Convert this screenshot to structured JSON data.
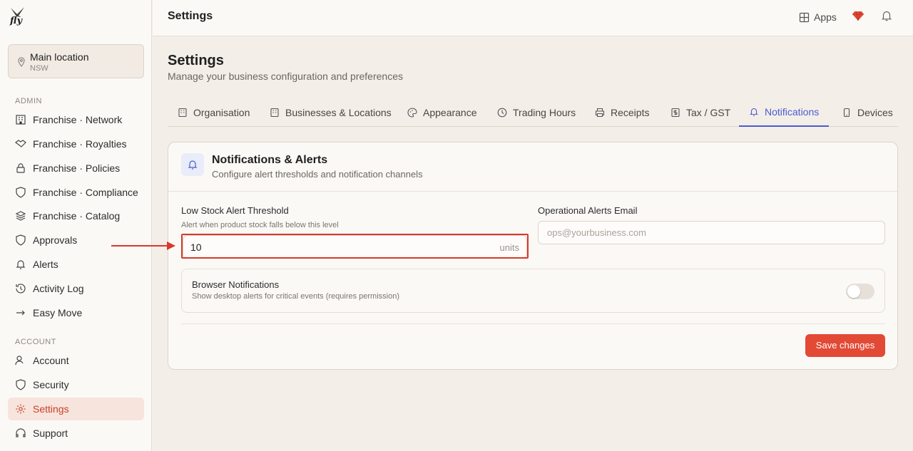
{
  "app": {
    "logo_text": "fly",
    "page_title": "Settings"
  },
  "location": {
    "name": "Main location",
    "sub": "NSW"
  },
  "sidebar": {
    "admin_label": "ADMIN",
    "admin_items": [
      {
        "label": "Franchise · Network",
        "icon": "building-icon"
      },
      {
        "label": "Franchise · Royalties",
        "icon": "handshake-icon"
      },
      {
        "label": "Franchise · Policies",
        "icon": "lock-icon"
      },
      {
        "label": "Franchise · Compliance",
        "icon": "shield-icon"
      },
      {
        "label": "Franchise · Catalog",
        "icon": "layers-icon"
      },
      {
        "label": "Approvals",
        "icon": "shield-check-icon"
      },
      {
        "label": "Alerts",
        "icon": "bell-icon"
      },
      {
        "label": "Activity Log",
        "icon": "history-icon"
      },
      {
        "label": "Easy Move",
        "icon": "arrow-right-icon"
      }
    ],
    "account_label": "ACCOUNT",
    "account_items": [
      {
        "label": "Account",
        "icon": "user-icon"
      },
      {
        "label": "Security",
        "icon": "shield-icon"
      },
      {
        "label": "Settings",
        "icon": "gear-icon",
        "active": true
      },
      {
        "label": "Support",
        "icon": "headset-icon"
      }
    ]
  },
  "topbar": {
    "apps_label": "Apps"
  },
  "main": {
    "title": "Settings",
    "subtitle": "Manage your business configuration and preferences",
    "tabs": [
      {
        "label": "Organisation"
      },
      {
        "label": "Businesses & Locations"
      },
      {
        "label": "Appearance"
      },
      {
        "label": "Trading Hours"
      },
      {
        "label": "Receipts"
      },
      {
        "label": "Tax / GST"
      },
      {
        "label": "Notifications",
        "active": true
      },
      {
        "label": "Devices"
      }
    ]
  },
  "card": {
    "title": "Notifications & Alerts",
    "subtitle": "Configure alert thresholds and notification channels",
    "low_stock": {
      "label": "Low Stock Alert Threshold",
      "help": "Alert when product stock falls below this level",
      "value": "10",
      "unit": "units"
    },
    "ops_email": {
      "label": "Operational Alerts Email",
      "placeholder": "ops@yourbusiness.com"
    },
    "browser_notif": {
      "title": "Browser Notifications",
      "sub": "Show desktop alerts for critical events (requires permission)",
      "enabled": false
    },
    "save_label": "Save changes"
  },
  "colors": {
    "accent": "#e24a35",
    "tab_active": "#4a5bd0",
    "highlight": "#d63a2a"
  }
}
